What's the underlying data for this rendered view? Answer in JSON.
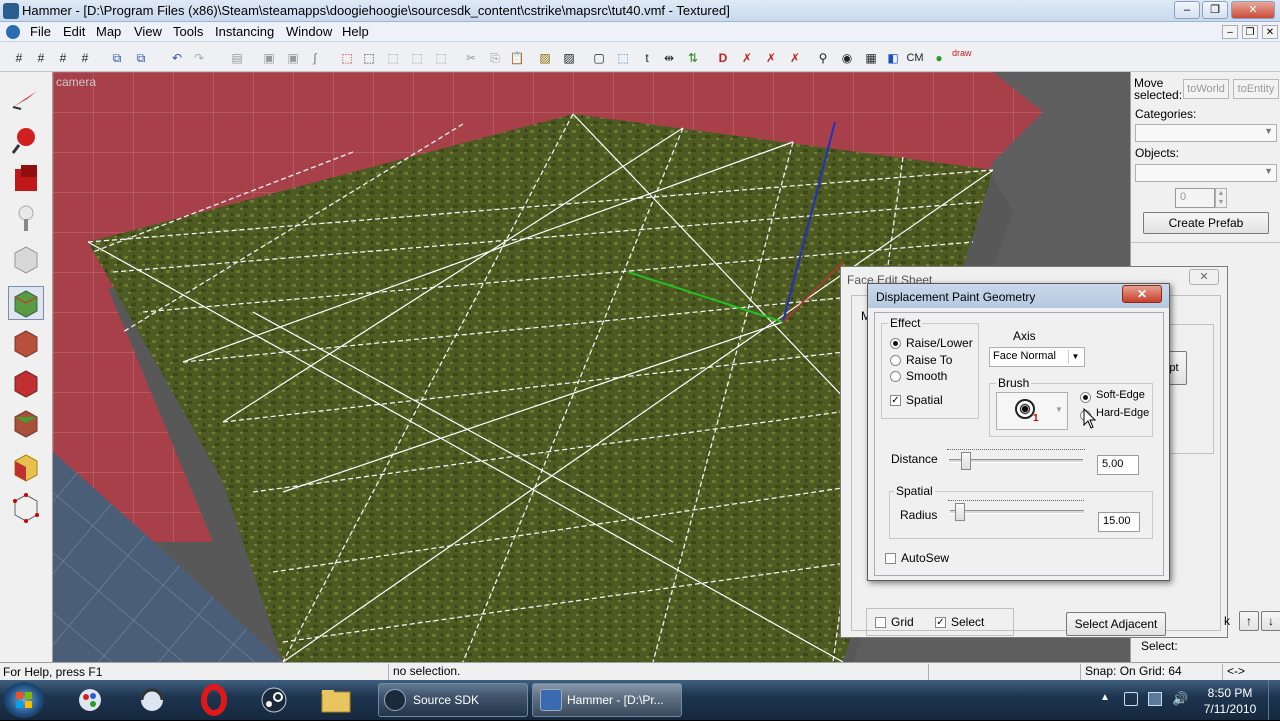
{
  "window": {
    "title": "Hammer - [D:\\Program Files (x86)\\Steam\\steamapps\\doogiehoogie\\sourcesdk_content\\cstrike\\mapsrc\\tut40.vmf - Textured]",
    "minimize": "–",
    "restore": "❐",
    "close": "✕"
  },
  "menu": {
    "items": [
      "File",
      "Edit",
      "Map",
      "View",
      "Tools",
      "Instancing",
      "Window",
      "Help"
    ],
    "mdi_minimize": "–",
    "mdi_restore": "❐",
    "mdi_close": "✕"
  },
  "toolbar": {
    "cm_label": "CM",
    "draw_label": "draw"
  },
  "viewport": {
    "label": "camera"
  },
  "right_panel": {
    "move_selected": "Move selected:",
    "to_world": "toWorld",
    "to_entity": "toEntity",
    "categories_label": "Categories:",
    "objects_label": "Objects:",
    "spin_value": "0",
    "create_prefab": "Create Prefab",
    "select_label": "Select:"
  },
  "face_edit_sheet": {
    "title": "Face Edit Sheet",
    "close": "✕",
    "partial_label_m": "M",
    "partial_button_text": "pt",
    "grid_label": "Grid",
    "grid_checked": false,
    "select_label": "Select",
    "select_checked": true,
    "select_adjacent": "Select Adjacent",
    "partial_k": "k",
    "up_arrow": "↑",
    "down_arrow": "↓"
  },
  "paint_dialog": {
    "title": "Displacement Paint Geometry",
    "close": "✕",
    "effect_group": "Effect",
    "effects": [
      {
        "label": "Raise/Lower",
        "selected": true
      },
      {
        "label": "Raise To",
        "selected": false
      },
      {
        "label": "Smooth",
        "selected": false
      }
    ],
    "spatial_label": "Spatial",
    "spatial_checked": true,
    "axis_label": "Axis",
    "axis_value": "Face Normal",
    "brush_group": "Brush",
    "brush_index": "1",
    "soft_edge": "Soft-Edge",
    "hard_edge": "Hard-Edge",
    "edge_selected": "Soft-Edge",
    "distance_label": "Distance",
    "distance_value": "5.00",
    "distance_slider": 0.1,
    "spatial_group": "Spatial",
    "radius_label": "Radius",
    "radius_value": "15.00",
    "radius_slider": 0.04,
    "autosew_label": "AutoSew",
    "autosew_checked": false
  },
  "status_bar": {
    "help": "For Help, press F1",
    "selection": "no selection.",
    "snap": "Snap: On Grid: 64",
    "arrows": "<->"
  },
  "taskbar": {
    "tasks": [
      "Source SDK",
      "Hammer - [D:\\Pr..."
    ],
    "time": "8:50 PM",
    "date": "7/11/2010",
    "tray_arrow": "▲"
  },
  "colors": {
    "wall_red": "#a8404a",
    "floor_blue": "#4a5e78",
    "grass": "#4d5a22",
    "axis_green": "#22c022",
    "axis_blue": "#2030c0"
  }
}
